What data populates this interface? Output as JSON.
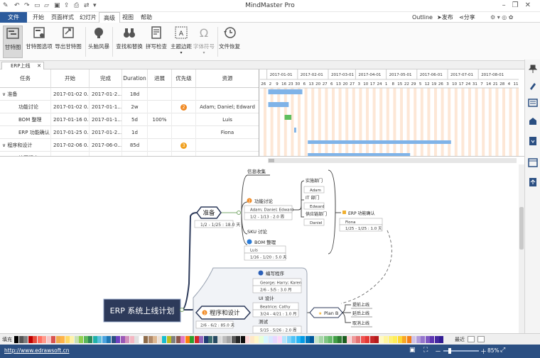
{
  "app": {
    "title": "MindMaster Pro"
  },
  "menu": {
    "file": "文件",
    "items": [
      "开始",
      "页面样式",
      "幻灯片",
      "高级",
      "视图",
      "帮助"
    ],
    "outline": "Outline",
    "publish": "发布",
    "share": "分享"
  },
  "ribbon": {
    "buttons": [
      "甘特图",
      "甘特图选项",
      "导出甘特图",
      "头脑风暴",
      "查找和替换",
      "拼写检查",
      "主题边距",
      "字体符号",
      "文件恢复"
    ]
  },
  "doc_tab": "ERP上线",
  "gantt": {
    "headers": [
      "任务",
      "开始",
      "完成",
      "Duration",
      "进展",
      "优先级",
      "资源"
    ],
    "rows": [
      {
        "task": "准备",
        "start": "2017-01-02 0…",
        "end": "2017-01-2…",
        "duration": "18d",
        "progress": "",
        "priority": "",
        "resource": "",
        "group": true
      },
      {
        "task": "功能讨论",
        "start": "2017-01-02 0…",
        "end": "2017-01-1…",
        "duration": "2w",
        "progress": "",
        "priority": "2",
        "resource": "Adam; Daniel; Edward"
      },
      {
        "task": "BOM 整理",
        "start": "2017-01-16 0…",
        "end": "2017-01-1…",
        "duration": "5d",
        "progress": "100%",
        "priority": "",
        "resource": "Luis"
      },
      {
        "task": "ERP 功能确认",
        "start": "2017-01-25 0…",
        "end": "2017-01-2…",
        "duration": "1d",
        "progress": "",
        "priority": "",
        "resource": "Fiona"
      },
      {
        "task": "程序和设计",
        "start": "2017-02-06 0…",
        "end": "2017-06-0…",
        "duration": "85d",
        "progress": "",
        "priority": "3",
        "resource": "",
        "group": true
      },
      {
        "task": "编写程序",
        "start": "2017-02-06 0…",
        "end": "2017-05-0…",
        "duration": "3mo",
        "progress": "75%",
        "priority": "",
        "resource": "George; Harry; Karen"
      }
    ],
    "months": [
      "2017-01-01",
      "2017-02-01",
      "2017-03-01",
      "2017-04-01",
      "2017-05-01",
      "2017-06-01",
      "2017-07-01",
      "2017-08-01"
    ],
    "days": [
      "26",
      "2",
      "9",
      "16",
      "23",
      "30",
      "6",
      "13",
      "20",
      "27",
      "6",
      "13",
      "20",
      "27",
      "3",
      "10",
      "17",
      "24",
      "1",
      "8",
      "15",
      "22",
      "29",
      "5",
      "12",
      "19",
      "26",
      "3",
      "10",
      "17",
      "24",
      "31",
      "7",
      "14",
      "21",
      "28",
      "4",
      "11"
    ]
  },
  "mindmap": {
    "root": "ERP 系统上线计划",
    "prepare": {
      "label": "准备",
      "date": "1/2 - 1/25 : 18.0 天"
    },
    "info": "信息收集",
    "discuss": {
      "label": "功能讨论",
      "people": "Adam; Daniel; Edward",
      "date": "1/2 - 1/13 : 2.0 周"
    },
    "depts": {
      "title": "实施部门",
      "it": "IT 部门",
      "supply": "供应链部门",
      "adam": "Adam",
      "edward": "Edward",
      "daniel": "Daniel"
    },
    "sku": "SKU 讨论",
    "bom": {
      "label": "BOM 整理",
      "person": "Luis",
      "date": "1/16 - 1/20 : 5.0 天"
    },
    "erp": {
      "label": "ERP 功能确认",
      "person": "Fiona",
      "date": "1/25 - 1/25 : 1.0 天"
    },
    "program": {
      "label": "程序和设计",
      "date": "2/6 - 6/2 : 85.0 天"
    },
    "write": {
      "label": "编写程序",
      "people": "George; Harry; Karen",
      "date": "2/6 - 5/5 : 3.0 月"
    },
    "ui": {
      "label": "UI 设计",
      "person": "Beatrice; Cathy",
      "date": "3/24 - 4/21 : 1.0 月"
    },
    "test": {
      "label": "测试",
      "date": "5/15 - 5/26 : 2.0 周"
    },
    "planb": "Plan B",
    "ext": [
      "提前上线",
      "延后上线",
      "取消上线"
    ]
  },
  "palette": {
    "fill": "填充",
    "recent": "最近"
  },
  "status": {
    "url": "http://www.edrawsoft.cn",
    "zoom": "85%"
  }
}
